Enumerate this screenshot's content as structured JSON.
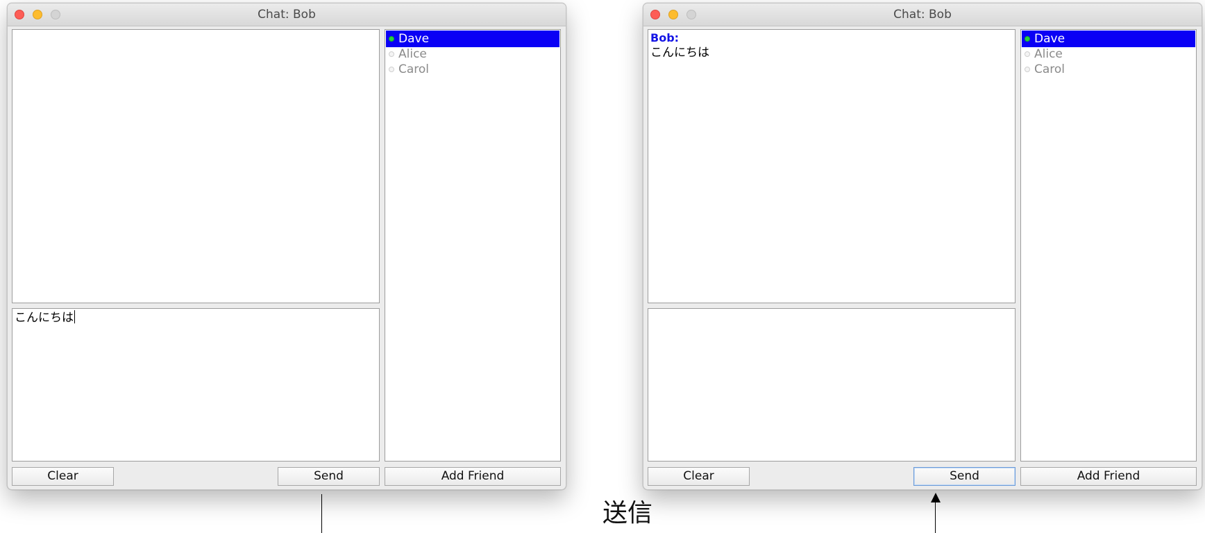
{
  "windows": [
    {
      "title": "Chat: Bob",
      "messages": [],
      "input_value": "こんにちは",
      "friends": [
        {
          "name": "Dave",
          "status": "online",
          "selected": true
        },
        {
          "name": "Alice",
          "status": "offline",
          "selected": false
        },
        {
          "name": "Carol",
          "status": "offline",
          "selected": false
        }
      ],
      "buttons": {
        "clear": "Clear",
        "send": "Send",
        "add_friend": "Add Friend"
      }
    },
    {
      "title": "Chat: Bob",
      "messages": [
        {
          "sender": "Bob:",
          "text": "こんにちは"
        }
      ],
      "input_value": "",
      "friends": [
        {
          "name": "Dave",
          "status": "online",
          "selected": true
        },
        {
          "name": "Alice",
          "status": "offline",
          "selected": false
        },
        {
          "name": "Carol",
          "status": "offline",
          "selected": false
        }
      ],
      "buttons": {
        "clear": "Clear",
        "send": "Send",
        "add_friend": "Add Friend"
      }
    }
  ],
  "annotation": {
    "label": "送信"
  },
  "colors": {
    "selected_row": "#0a00f5",
    "sender_name": "#1414e6",
    "online_dot": "#27d13d",
    "offline_text": "#8a8a8a"
  }
}
